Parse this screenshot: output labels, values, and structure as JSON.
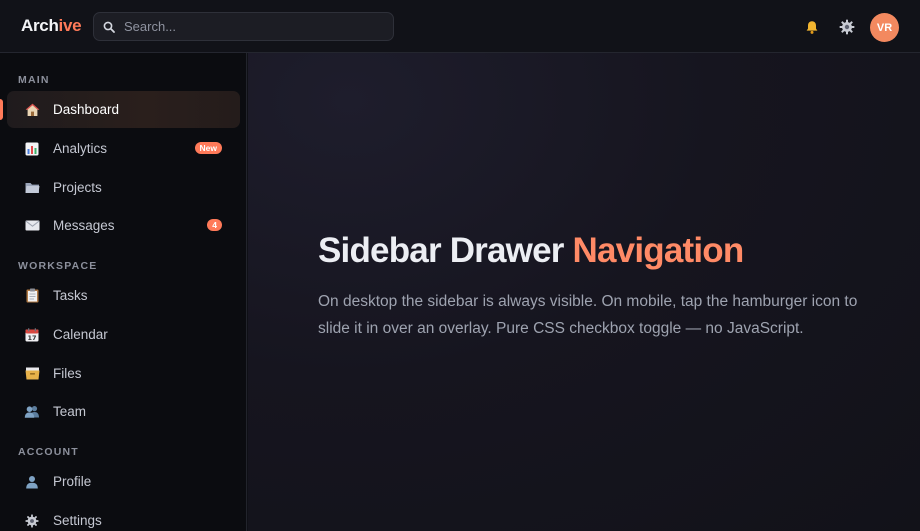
{
  "app": {
    "logo_main": "Arch",
    "logo_accent": "ive"
  },
  "header": {
    "search_placeholder": "Search...",
    "avatar_initials": "VR",
    "icons": [
      "search-icon",
      "bell-icon",
      "gear-icon"
    ]
  },
  "sidebar": {
    "sections": [
      {
        "label": "MAIN",
        "items": [
          {
            "label": "Dashboard",
            "icon": "home-icon",
            "active": true
          },
          {
            "label": "Analytics",
            "icon": "chart-icon",
            "badge": "New"
          },
          {
            "label": "Projects",
            "icon": "folder-icon"
          },
          {
            "label": "Messages",
            "icon": "envelope-icon",
            "badge": "4"
          }
        ]
      },
      {
        "label": "WORKSPACE",
        "items": [
          {
            "label": "Tasks",
            "icon": "clipboard-icon"
          },
          {
            "label": "Calendar",
            "icon": "calendar-icon"
          },
          {
            "label": "Files",
            "icon": "file-box-icon"
          },
          {
            "label": "Team",
            "icon": "team-icon"
          }
        ]
      },
      {
        "label": "ACCOUNT",
        "items": [
          {
            "label": "Profile",
            "icon": "user-icon"
          },
          {
            "label": "Settings",
            "icon": "gear-icon"
          }
        ]
      }
    ]
  },
  "main": {
    "title_main": "Sidebar Drawer",
    "title_accent": "Navigation",
    "description": "On desktop the sidebar is always visible. On mobile, tap the hamburger icon to slide it in over an overlay. Pure CSS checkbox toggle — no JavaScript."
  },
  "colors": {
    "accent": "#ff7a59",
    "background": "#0f1016",
    "sidebar_bg": "#0b0c10"
  }
}
